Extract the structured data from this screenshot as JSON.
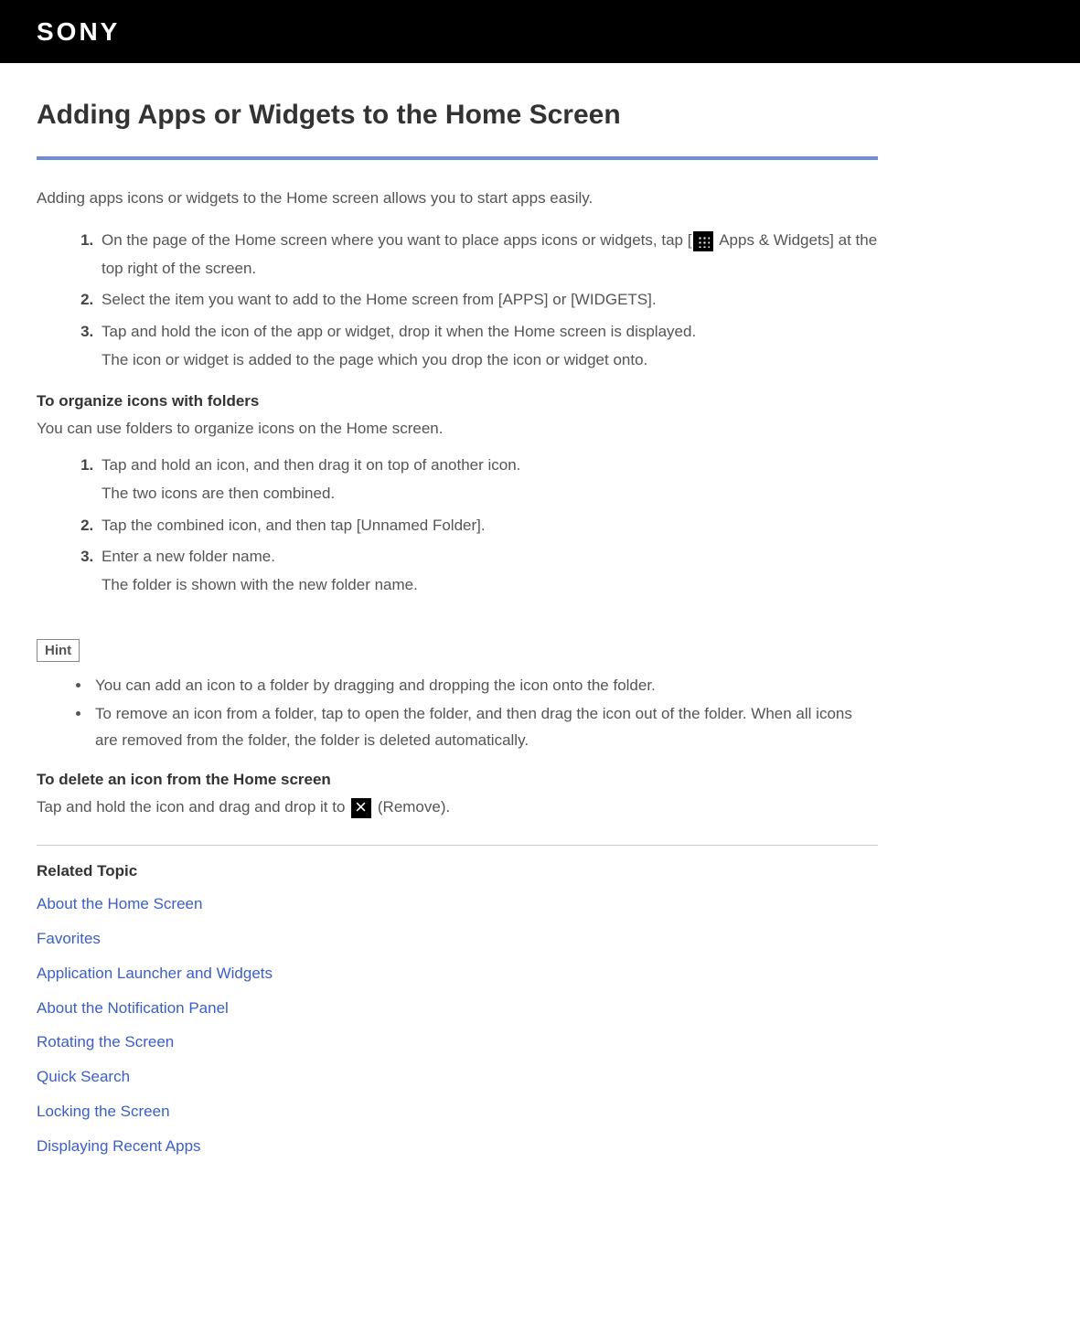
{
  "header": {
    "logo": "SONY"
  },
  "page": {
    "title": "Adding Apps or Widgets to the Home Screen",
    "intro": "Adding apps icons or widgets to the Home screen allows you to start apps easily.",
    "steps": {
      "s1_pre": "On the page of the Home screen where you want to place apps icons or widgets, tap [",
      "s1_post": " Apps & Widgets] at the top right of the screen.",
      "s2": "Select the item you want to add to the Home screen from [APPS] or [WIDGETS].",
      "s3_line1": "Tap and hold the icon of the app or widget, drop it when the Home screen is displayed.",
      "s3_line2": "The icon or widget is added to the page which you drop the icon or widget onto."
    },
    "organize": {
      "heading": "To organize icons with folders",
      "intro": "You can use folders to organize icons on the Home screen.",
      "s1_line1": "Tap and hold an icon, and then drag it on top of another icon.",
      "s1_line2": "The two icons are then combined.",
      "s2": "Tap the combined icon, and then tap [Unnamed Folder].",
      "s3_line1": "Enter a new folder name.",
      "s3_line2": "The folder is shown with the new folder name."
    },
    "hint": {
      "label": "Hint",
      "h1": "You can add an icon to a folder by dragging and dropping the icon onto the folder.",
      "h2": "To remove an icon from a folder, tap to open the folder, and then drag the icon out of the folder. When all icons are removed from the folder, the folder is deleted automatically."
    },
    "delete": {
      "heading": "To delete an icon from the Home screen",
      "text_pre": "Tap and hold the icon and drag and drop it to ",
      "text_post": " (Remove)."
    },
    "related": {
      "heading": "Related Topic",
      "links": [
        "About the Home Screen",
        "Favorites",
        "Application Launcher and Widgets",
        "About the Notification Panel",
        "Rotating the Screen",
        "Quick Search",
        "Locking the Screen",
        "Displaying Recent Apps"
      ]
    }
  }
}
